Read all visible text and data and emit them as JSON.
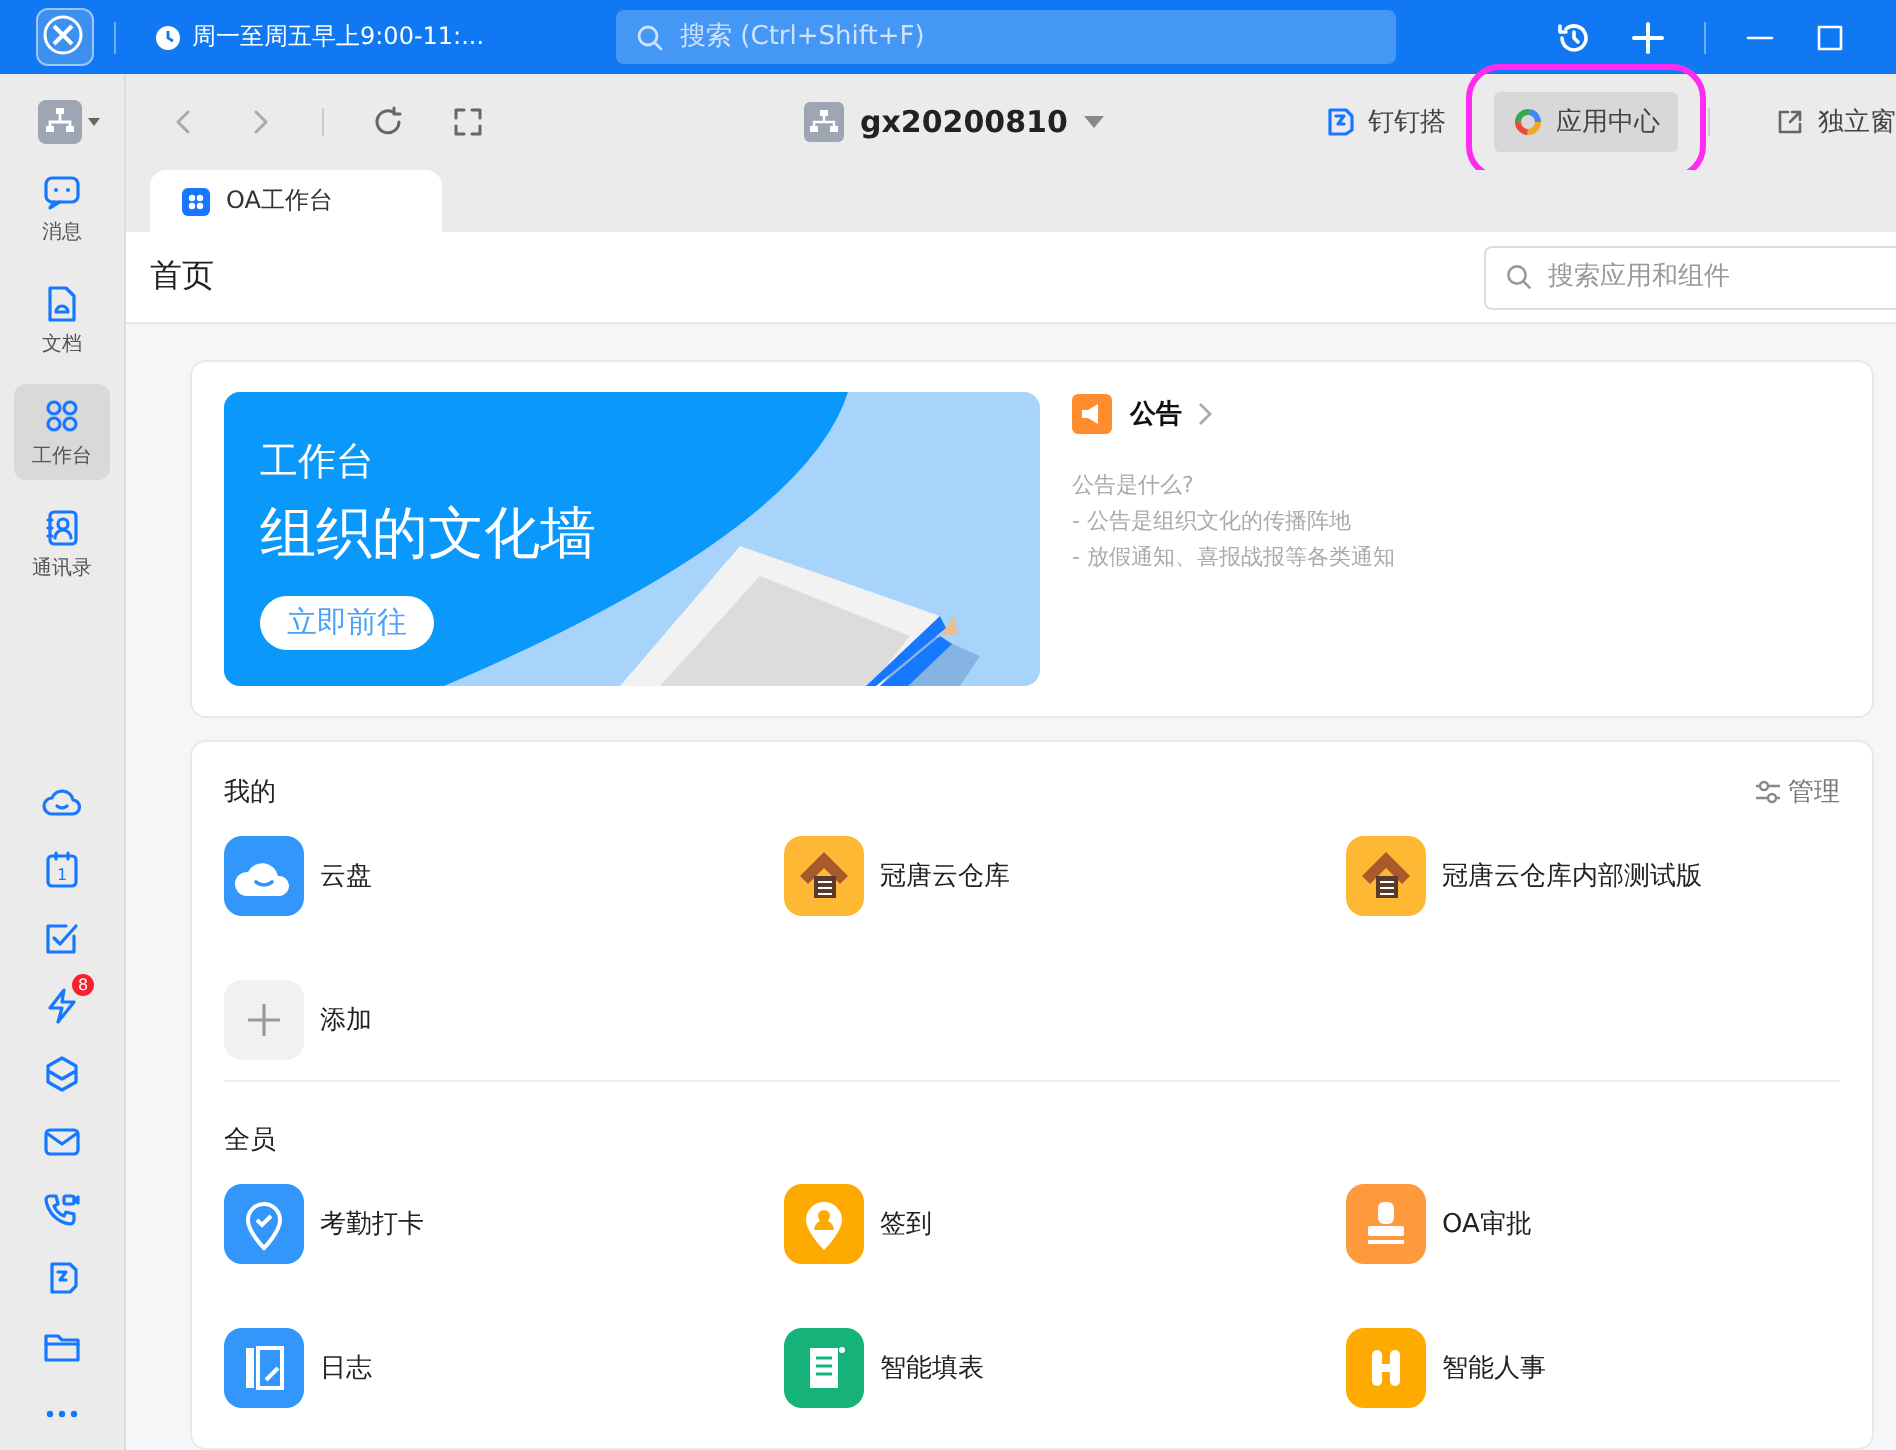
{
  "title_bar": {
    "meeting": "周一至周五早上9:00-11:...",
    "search": {
      "placeholder": "搜索 (Ctrl+Shift+F)"
    }
  },
  "sidebar": {
    "nav": [
      {
        "label": "消息",
        "kind": "chat",
        "selected": false
      },
      {
        "label": "文档",
        "kind": "doc",
        "selected": false
      },
      {
        "label": "工作台",
        "kind": "grid",
        "selected": true
      },
      {
        "label": "通讯录",
        "kind": "contacts",
        "selected": false
      }
    ],
    "tools": [
      {
        "kind": "cloud"
      },
      {
        "kind": "calendar",
        "day": "1"
      },
      {
        "kind": "todo"
      },
      {
        "kind": "flash",
        "badge": "8"
      },
      {
        "kind": "layers"
      },
      {
        "kind": "mail"
      },
      {
        "kind": "call"
      },
      {
        "kind": "ding"
      },
      {
        "kind": "folder"
      },
      {
        "kind": "more"
      }
    ]
  },
  "toolbar": {
    "org": "gx20200810",
    "actions": [
      {
        "label": "钉钉搭",
        "kind": "ding",
        "highlighted": false
      },
      {
        "label": "应用中心",
        "kind": "appcenter",
        "highlighted": true
      },
      {
        "label": "独立窗",
        "kind": "popout",
        "highlighted": false
      }
    ]
  },
  "tabs": [
    {
      "label": "OA工作台",
      "selected": true
    }
  ],
  "page": {
    "title": "首页",
    "search": {
      "placeholder": "搜索应用和组件"
    }
  },
  "banner": {
    "subtitle": "工作台",
    "headline": "组织的文化墙",
    "button": "立即前往"
  },
  "announcement": {
    "title": "公告",
    "lines": [
      "公告是什么?",
      "- 公告是组织文化的传播阵地",
      "- 放假通知、喜报战报等各类通知"
    ]
  },
  "sections": [
    {
      "title": "我的",
      "action": "管理",
      "apps": [
        {
          "name": "云盘",
          "kind": "cloud",
          "color": "#3296fa"
        },
        {
          "name": "冠唐云仓库",
          "kind": "warehouse",
          "color": "#ffb833"
        },
        {
          "name": "冠唐云仓库内部测试版",
          "kind": "warehouse",
          "color": "#ffb833"
        },
        {
          "name": "添加",
          "kind": "add",
          "color": "#f0f1f2"
        }
      ]
    },
    {
      "title": "全员",
      "apps": [
        {
          "name": "考勤打卡",
          "kind": "pin",
          "color": "#3296fa"
        },
        {
          "name": "签到",
          "kind": "person-pin",
          "color": "#ffaa00"
        },
        {
          "name": "OA审批",
          "kind": "stamp",
          "color": "#ff9a3c"
        },
        {
          "name": "日志",
          "kind": "journal",
          "color": "#3296fa"
        },
        {
          "name": "智能填表",
          "kind": "form",
          "color": "#15b37a"
        },
        {
          "name": "智能人事",
          "kind": "hr",
          "color": "#ffaa00"
        }
      ]
    }
  ]
}
